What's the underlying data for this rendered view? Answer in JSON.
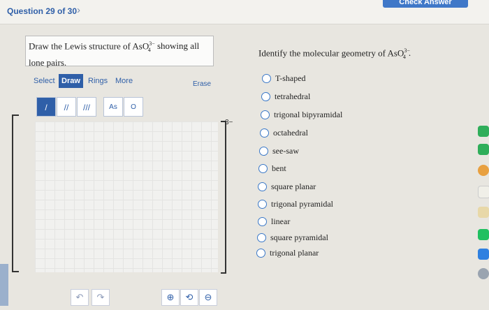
{
  "header": {
    "question_label": "Question 29 of 30",
    "next_chevron": "›",
    "check_answer": "Check Answer"
  },
  "left": {
    "prompt_line1": "Draw the Lewis structure of AsO",
    "prompt_sup": "3−",
    "prompt_sub": "4",
    "prompt_after": " showing all",
    "prompt_line2": "lone pairs.",
    "tabs": [
      "Select",
      "Draw",
      "Rings",
      "More"
    ],
    "erase": "Erase",
    "bond_buttons": [
      "/",
      "//",
      "///",
      "As",
      "O"
    ],
    "charge": "3−"
  },
  "right": {
    "question": "Identify the molecular geometry of AsO",
    "question_sup": "3−",
    "question_sub": "4",
    "question_end": ".",
    "options": [
      "T-shaped",
      "tetrahedral",
      "trigonal bipyramidal",
      "octahedral",
      "see-saw",
      "bent",
      "square planar",
      "trigonal pyramidal",
      "linear",
      "square pyramidal",
      "trigonal planar"
    ]
  },
  "colors": {
    "accent": "#2f5fa8",
    "radio_border": "#3a78c8"
  }
}
